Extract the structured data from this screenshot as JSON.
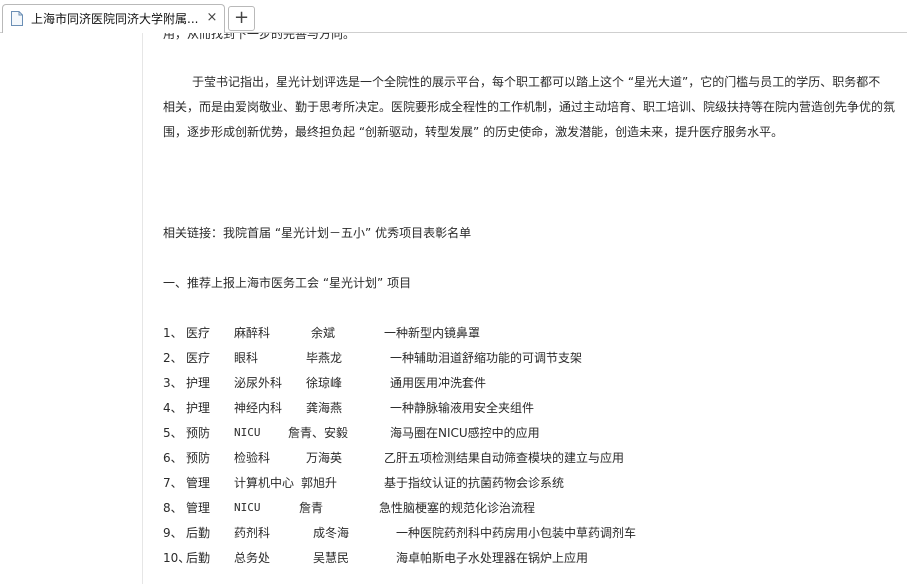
{
  "tab": {
    "title": "上海市同济医院同济大学附属...",
    "close_symbol": "×",
    "new_tab_symbol": "+"
  },
  "article": {
    "cut_line": "用，从而找到下一步的完善与方向。",
    "paragraph": [
      "于莹书记指出，星光计划评选是一个全院性的展示平台，每个职工都可以踏上这个 “星光大道”，它的门槛与员工的学历、职务都不",
      "相关，而是由爱岗敬业、勤于思考所决定。医院要形成全程性的工作机制，通过主动培育、职工培训、院级扶持等在院内营造创先争优的氛",
      "围，逐步形成创新优势，最终担负起 “创新驱动，转型发展” 的历史使命，激发潜能，创造未来，提升医疗服务水平。"
    ],
    "related_link": "相关链接：我院首届 “星光计划－五小” 优秀项目表彰名单",
    "section_heading": "一、推荐上报上海市医务工会 “星光计划” 项目",
    "rows": [
      {
        "num": "1、",
        "type": "医疗",
        "dept": "麻醉科",
        "name": "余斌",
        "project": "一种新型内镜鼻罩"
      },
      {
        "num": "2、",
        "type": "医疗",
        "dept": "眼科",
        "name": "毕燕龙",
        "project": "一种辅助泪道舒缩功能的可调节支架"
      },
      {
        "num": "3、",
        "type": "护理",
        "dept": "泌尿外科",
        "name": "徐琼峰",
        "project": "通用医用冲洗套件"
      },
      {
        "num": "4、",
        "type": "护理",
        "dept": "神经内科",
        "name": "龚海燕",
        "project": "一种静脉输液用安全夹组件"
      },
      {
        "num": "5、",
        "type": "预防",
        "dept": "NICU",
        "name": "詹青、安毅",
        "project": "海马圈在NICU感控中的应用"
      },
      {
        "num": "6、",
        "type": "预防",
        "dept": "检验科",
        "name": "万海英",
        "project": "乙肝五项检测结果自动筛查模块的建立与应用"
      },
      {
        "num": "7、",
        "type": "管理",
        "dept": "计算机中心",
        "name": "郭旭升",
        "project": "基于指纹认证的抗菌药物会诊系统"
      },
      {
        "num": "8、",
        "type": "管理",
        "dept": "NICU",
        "name": "詹青",
        "project": "急性脑梗塞的规范化诊治流程"
      },
      {
        "num": "9、",
        "type": "后勤",
        "dept": "药剂科",
        "name": "成冬海",
        "project": "一种医院药剂科中药房用小包装中草药调剂车"
      },
      {
        "num": "10、",
        "type": "后勤",
        "dept": "总务处",
        "name": "吴慧民",
        "project": "海卓帕斯电子水处理器在锅炉上应用"
      }
    ]
  }
}
